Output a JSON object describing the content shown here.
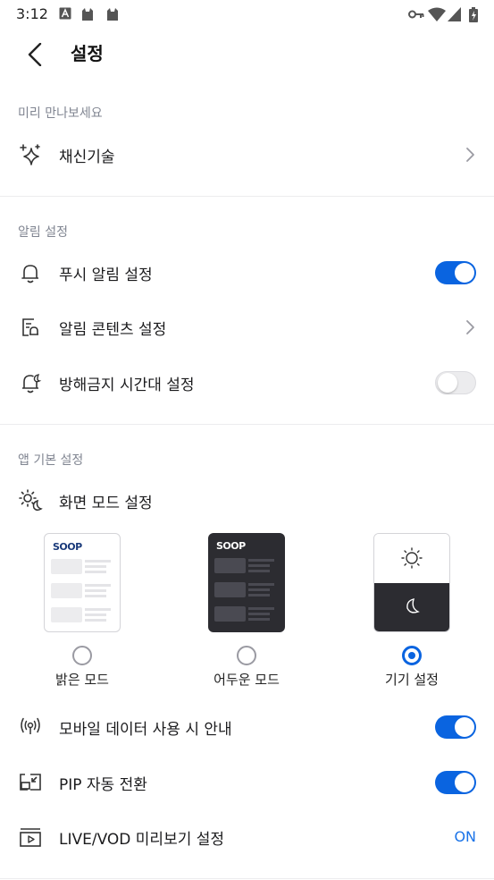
{
  "status": {
    "time": "3:12"
  },
  "header": {
    "title": "설정"
  },
  "sections": {
    "preview": {
      "label": "미리 만나보세요",
      "items": {
        "new_tech": "채신기술"
      }
    },
    "notifications": {
      "label": "알림 설정",
      "push": {
        "label": "푸시 알림 설정",
        "on": true
      },
      "content": {
        "label": "알림 콘텐츠 설정"
      },
      "dnd": {
        "label": "방해금지 시간대 설정",
        "on": false
      }
    },
    "app": {
      "label": "앱 기본 설정",
      "screen_mode": {
        "label": "화면 모드 설정",
        "brand_text": "SOOP",
        "options": [
          "밝은 모드",
          "어두운 모드",
          "기기 설정"
        ],
        "selected": "기기 설정"
      },
      "mobile_data": {
        "label": "모바일 데이터 사용 시 안내",
        "on": true
      },
      "pip": {
        "label": "PIP 자동 전환",
        "on": true
      },
      "preview": {
        "label": "LIVE/VOD 미리보기 설정",
        "value": "ON"
      }
    }
  },
  "colors": {
    "accent": "#0a64e0",
    "on_text": "#1a73e8",
    "section_label": "#808591",
    "dark_card": "#2c2c31"
  },
  "icons": [
    "key-icon",
    "wifi-icon",
    "signal-icon",
    "battery-icon",
    "back-arrow-icon",
    "sparkle-icon",
    "bell-icon",
    "notification-content-icon",
    "dnd-bell-icon",
    "screen-mode-icon",
    "broadcast-icon",
    "pip-icon",
    "video-preview-icon",
    "chevron-right-icon"
  ]
}
